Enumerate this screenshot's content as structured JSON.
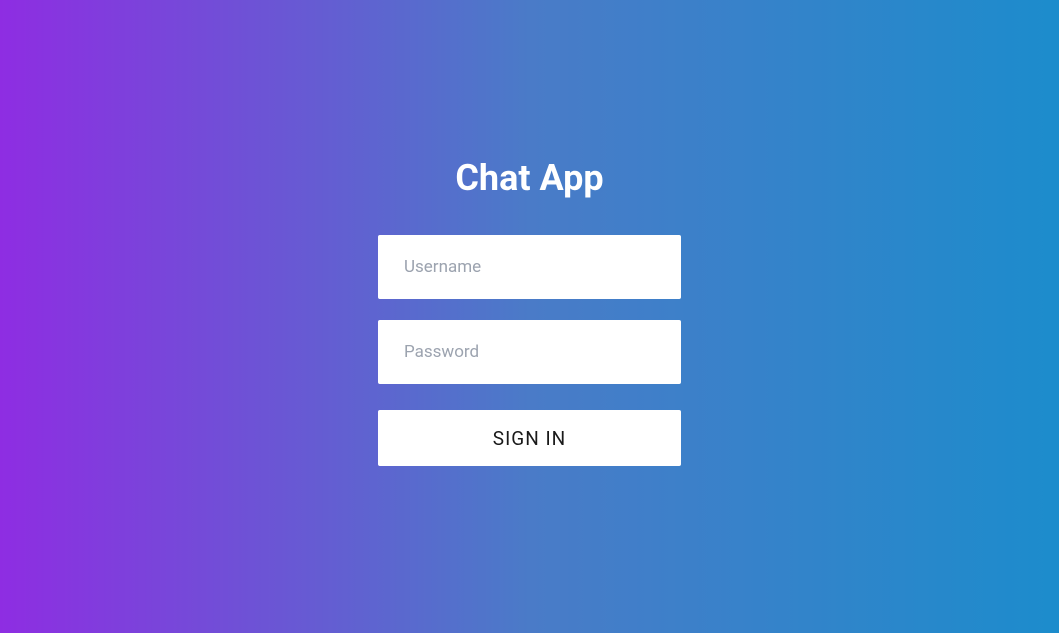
{
  "app": {
    "title": "Chat App"
  },
  "form": {
    "username": {
      "placeholder": "Username",
      "value": ""
    },
    "password": {
      "placeholder": "Password",
      "value": ""
    },
    "submit_label": "SIGN IN"
  }
}
